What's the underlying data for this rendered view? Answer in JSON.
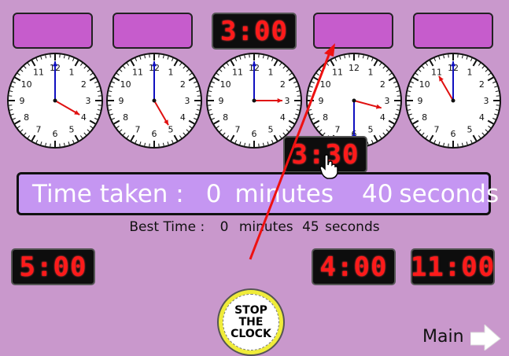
{
  "answer_slots": [
    {
      "value": ""
    },
    {
      "value": ""
    },
    {
      "value": "3:00"
    },
    {
      "value": ""
    },
    {
      "value": ""
    }
  ],
  "clocks": [
    {
      "hour_hand": 4,
      "minute": 0
    },
    {
      "hour_hand": 5,
      "minute": 0
    },
    {
      "hour_hand": 3,
      "minute": 0
    },
    {
      "hour_hand": 3.5,
      "minute": 30
    },
    {
      "hour_hand": 11,
      "minute": 0
    }
  ],
  "dragging_card": {
    "value": "3:30"
  },
  "cards": [
    {
      "value": "5:00"
    },
    {
      "value": "4:00"
    },
    {
      "value": "11:00"
    }
  ],
  "timer": {
    "label": "Time taken :",
    "minutes": "0",
    "minutes_unit": "minutes",
    "seconds": "40",
    "seconds_unit": "seconds"
  },
  "best": {
    "label": "Best Time :",
    "minutes": "0",
    "minutes_unit": "minutes",
    "seconds": "45",
    "seconds_unit": "seconds"
  },
  "stop_button": {
    "line1": "STOP",
    "line2": "THE",
    "line3": "CLOCK"
  },
  "main_link": {
    "label": "Main"
  },
  "colors": {
    "slot": "#c65ccc",
    "digit": "#ff1a1a",
    "background": "#c998cc",
    "hour_hand": "#e01010",
    "minute_hand": "#1010c0"
  }
}
